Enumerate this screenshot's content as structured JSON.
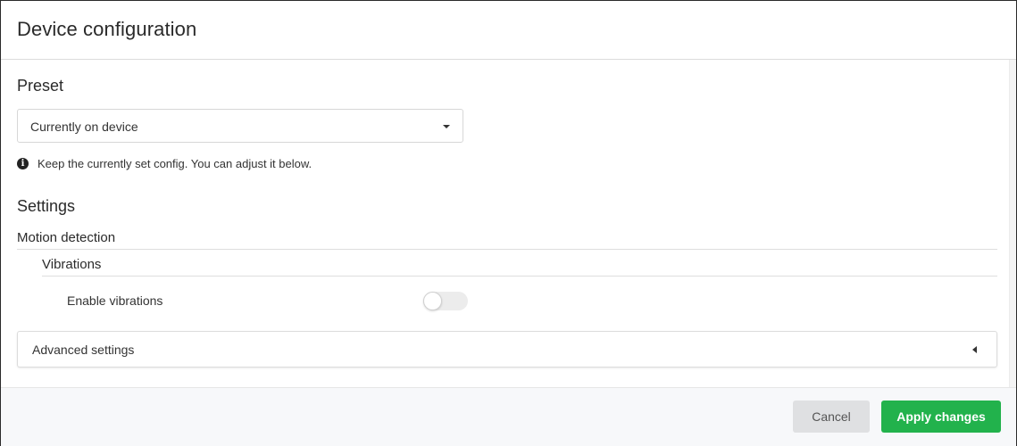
{
  "dialog": {
    "title": "Device configuration"
  },
  "preset": {
    "heading": "Preset",
    "selected": "Currently on device",
    "info_icon": "info-circle-icon",
    "info_text": "Keep the currently set config. You can adjust it below."
  },
  "settings": {
    "heading": "Settings",
    "group": "Motion detection",
    "subgroup": "Vibrations",
    "enable_vibrations_label": "Enable vibrations",
    "enable_vibrations_value": false,
    "advanced_label": "Advanced settings",
    "advanced_icon": "caret-left-icon"
  },
  "footer": {
    "cancel_label": "Cancel",
    "apply_label": "Apply changes"
  },
  "colors": {
    "apply": "#22b24c",
    "cancel": "#dfe0e2",
    "footer_bg": "#f7f8fa"
  }
}
